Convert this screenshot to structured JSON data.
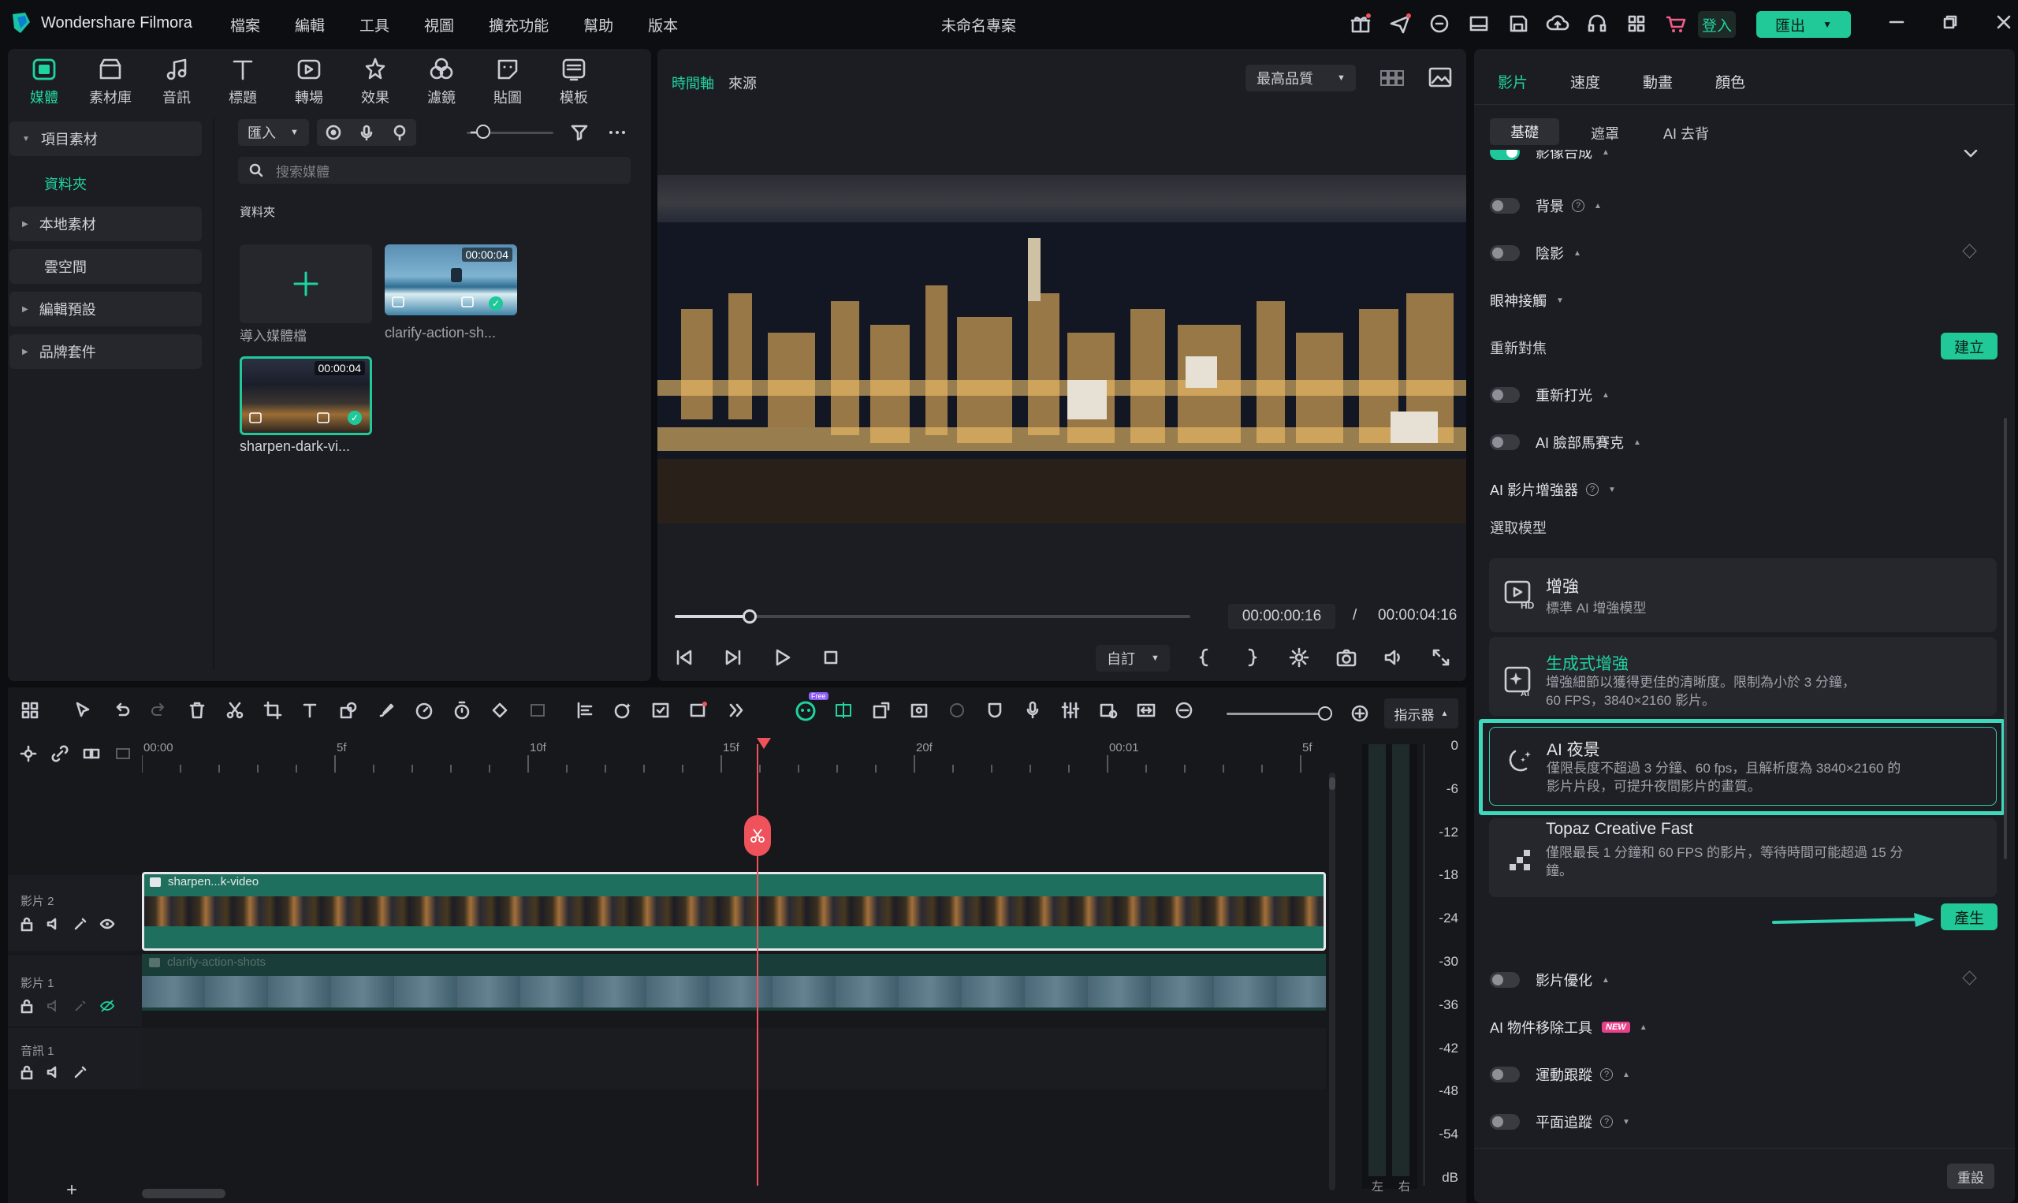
{
  "app": {
    "name": "Wondershare Filmora",
    "project_title": "未命名專案"
  },
  "menu": [
    "檔案",
    "編輯",
    "工具",
    "視圖",
    "擴充功能",
    "幫助",
    "版本"
  ],
  "titlebar": {
    "login": "登入",
    "export": "匯出"
  },
  "media_tools": [
    {
      "label": "媒體",
      "icon": "media-icon",
      "active": true
    },
    {
      "label": "素材庫",
      "icon": "stock-icon"
    },
    {
      "label": "音訊",
      "icon": "music-icon"
    },
    {
      "label": "標題",
      "icon": "title-icon"
    },
    {
      "label": "轉場",
      "icon": "transition-icon"
    },
    {
      "label": "效果",
      "icon": "effects-icon"
    },
    {
      "label": "濾鏡",
      "icon": "filters-icon"
    },
    {
      "label": "貼圖",
      "icon": "stickers-icon"
    },
    {
      "label": "模板",
      "icon": "templates-icon"
    }
  ],
  "sidebar": {
    "project_media": "項目素材",
    "folder": "資料夾",
    "local_media": "本地素材",
    "cloud": "雲空間",
    "presets": "編輯預設",
    "brand_kit": "品牌套件"
  },
  "media_panel": {
    "import_label": "匯入",
    "search_placeholder": "搜索媒體",
    "folder_heading": "資料夾",
    "import_tile_label": "導入媒體檔",
    "clips": [
      {
        "name": "clarify-action-sh...",
        "duration": "00:00:04"
      },
      {
        "name": "sharpen-dark-vi...",
        "duration": "00:00:04"
      }
    ]
  },
  "preview": {
    "tab_timeline": "時間軸",
    "tab_source": "來源",
    "quality": "最高品質",
    "current_time": "00:00:00:16",
    "separator": "/",
    "total_time": "00:00:04:16",
    "ratio_label": "自訂",
    "progress": 0.145
  },
  "right_panel": {
    "tabs": [
      "影片",
      "速度",
      "動畫",
      "顏色"
    ],
    "subtabs": [
      "基礎",
      "遮罩",
      "AI 去背"
    ],
    "compositing": "影像合成",
    "background": "背景",
    "shadow": "陰影",
    "eye_contact": "眼神接觸",
    "refocus": "重新對焦",
    "create_btn": "建立",
    "relight": "重新打光",
    "ai_face_mosaic": "AI 臉部馬賽克",
    "ai_enhancer": "AI 影片增強器",
    "select_model": "選取模型",
    "models": [
      {
        "title": "增強",
        "desc": "標準 AI 增強模型",
        "icon": "hd-icon"
      },
      {
        "title": "生成式增強",
        "desc": "增強細節以獲得更佳的清晰度。限制為小於 3 分鐘，\n60 FPS，3840×2160 影片。",
        "icon": "ai-sparkle-icon"
      },
      {
        "title": "AI 夜景",
        "desc": "僅限長度不超過 3 分鐘、60 fps，且解析度為 3840×2160 的\n影片片段，可提升夜間影片的畫質。",
        "icon": "night-moon-icon"
      },
      {
        "title": "Topaz Creative Fast",
        "desc": "僅限最長 1 分鐘和 60 FPS 的影片，等待時間可能超過 15 分\n鐘。",
        "icon": "topaz-icon"
      }
    ],
    "generate_btn": "產生",
    "video_optimize": "影片優化",
    "ai_object_remover": "AI 物件移除工具",
    "new_badge": "NEW",
    "motion_tracking": "運動跟蹤",
    "planar_tracking": "平面追蹤",
    "reset_btn": "重設"
  },
  "timeline": {
    "meter_label": "指示器",
    "free_badge": "Free",
    "ruler": [
      "00:00",
      "5f",
      "10f",
      "15f",
      "20f",
      "00:01",
      "5f"
    ],
    "tracks": [
      {
        "label": "影片 2",
        "clip": "sharpen...k-video"
      },
      {
        "label": "影片 1",
        "clip": "clarify-action-shots"
      },
      {
        "label": "音訊 1",
        "clip": ""
      }
    ],
    "db_scale": [
      "0",
      "-6",
      "-12",
      "-18",
      "-24",
      "-30",
      "-36",
      "-42",
      "-48",
      "-54",
      "dB"
    ],
    "meter_channels": [
      "左",
      "右"
    ],
    "playhead_frame": 15
  },
  "colors": {
    "accent": "#1fd3a1",
    "highlight": "#20c997",
    "playhead": "#f0525b",
    "clip_bg": "#1f6f5e"
  }
}
